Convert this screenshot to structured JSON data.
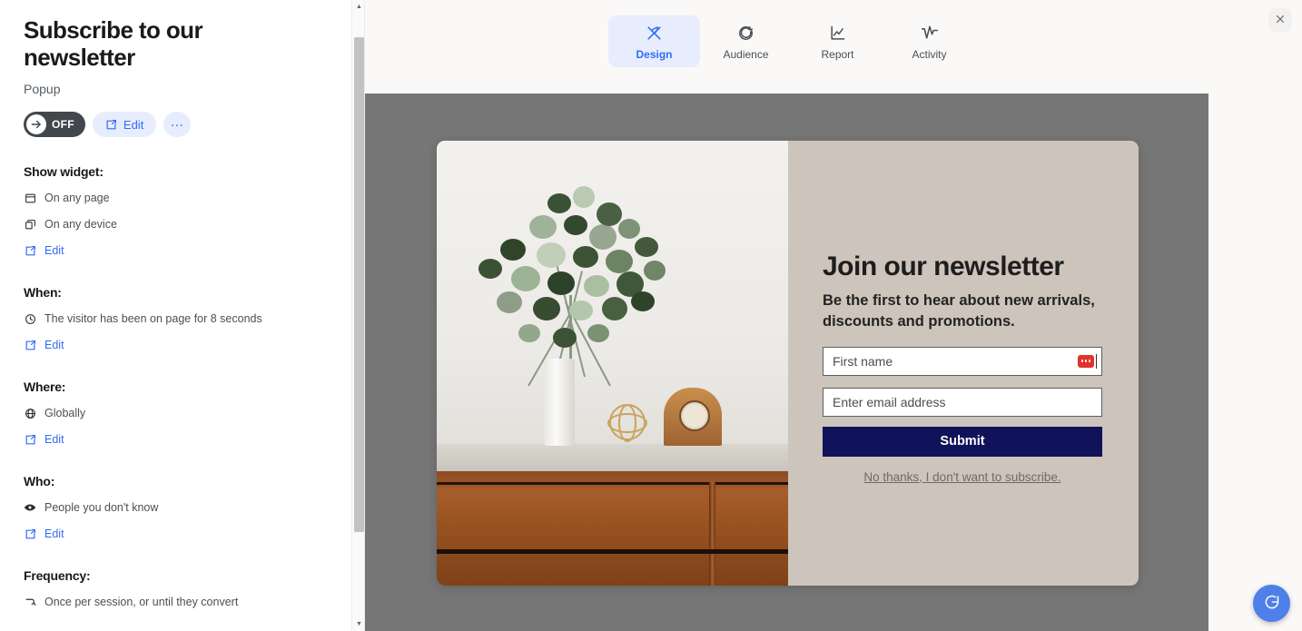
{
  "sidebar": {
    "title": "Subscribe to our newsletter",
    "subtitle": "Popup",
    "toggle": {
      "label": "OFF",
      "state": "off"
    },
    "edit_button": "Edit",
    "more_button": "…",
    "sections": [
      {
        "title": "Show widget:",
        "rows": [
          {
            "icon": "page-icon",
            "text": "On any page"
          },
          {
            "icon": "devices-icon",
            "text": "On any device"
          }
        ],
        "edit_label": "Edit"
      },
      {
        "title": "When:",
        "rows": [
          {
            "icon": "clock-icon",
            "text": "The visitor has been on page for 8 seconds"
          }
        ],
        "edit_label": "Edit"
      },
      {
        "title": "Where:",
        "rows": [
          {
            "icon": "globe-icon",
            "text": "Globally"
          }
        ],
        "edit_label": "Edit"
      },
      {
        "title": "Who:",
        "rows": [
          {
            "icon": "eye-icon",
            "text": "People you don't know"
          }
        ],
        "edit_label": "Edit"
      },
      {
        "title": "Frequency:",
        "rows": [
          {
            "icon": "repeat-icon",
            "text": "Once per session, or until they convert"
          }
        ],
        "edit_label": ""
      }
    ]
  },
  "tabs": [
    {
      "label": "Design",
      "icon": "design-icon",
      "active": true
    },
    {
      "label": "Audience",
      "icon": "audience-icon",
      "active": false
    },
    {
      "label": "Report",
      "icon": "report-icon",
      "active": false
    },
    {
      "label": "Activity",
      "icon": "activity-icon",
      "active": false
    }
  ],
  "close_button": "×",
  "popup_preview": {
    "heading": "Join our newsletter",
    "subheading": "Be the first to hear about new arrivals, discounts and promotions.",
    "fields": [
      {
        "name": "first-name",
        "placeholder": "First name",
        "value": ""
      },
      {
        "name": "email",
        "placeholder": "Enter email address",
        "value": ""
      }
    ],
    "submit_label": "Submit",
    "decline_label": "No thanks, I don't want to subscribe.",
    "image_alt": "Eucalyptus bouquet in vase on wooden dresser"
  },
  "help_bubble": "chat-icon",
  "colors": {
    "accent_blue": "#2f6df6",
    "accent_blue_bg": "#e8edfd",
    "toggle_off": "#42474c",
    "overlay_gray": "#767676",
    "popup_panel": "#cdc4bb",
    "submit_navy": "#10135a",
    "cursor_red": "#e0342c",
    "help_blue": "#4f7fe8"
  }
}
